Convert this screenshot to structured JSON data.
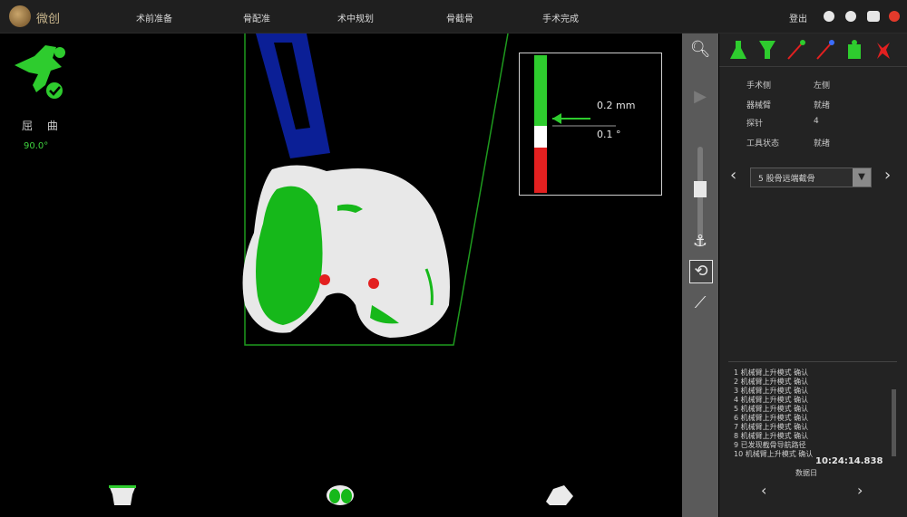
{
  "header": {
    "brand": "微创",
    "nav": [
      "术前准备",
      "骨配准",
      "术中规划",
      "骨截骨",
      "手术完成"
    ],
    "login": "登出"
  },
  "status": {
    "pose_label": "屈 曲",
    "pose_value": "90.0°"
  },
  "gauge": {
    "distance": "0.2 mm",
    "angle": "0.1 °"
  },
  "right_panel": {
    "info": [
      {
        "label": "手术侧",
        "value": "左侧"
      },
      {
        "label": "器械臂",
        "value": "就绪"
      },
      {
        "label": "探针",
        "value": "4"
      },
      {
        "label": "工具状态",
        "value": "就绪"
      }
    ],
    "selector_value": "5 股骨远端截骨",
    "log": [
      "1 机械臂上升模式   确认",
      "2 机械臂上升模式   确认",
      "3 机械臂上升模式   确认",
      "4 机械臂上升模式   确认",
      "5 机械臂上升模式   确认",
      "6 机械臂上升模式   确认",
      "7 机械臂上升模式   确认",
      "8 机械臂上升模式   确认",
      "9 已发现截骨导航路径",
      "10 机械臂上升模式   确认"
    ],
    "timestamp": "10:24:14.838",
    "timestamp_sub": "数据日"
  },
  "colors": {
    "accent_green": "#2ecc2e",
    "warning_red": "#e32020",
    "blade_blue": "#0b1f96",
    "panel_bg": "#232323",
    "tool_column": "#5a5a5a"
  }
}
